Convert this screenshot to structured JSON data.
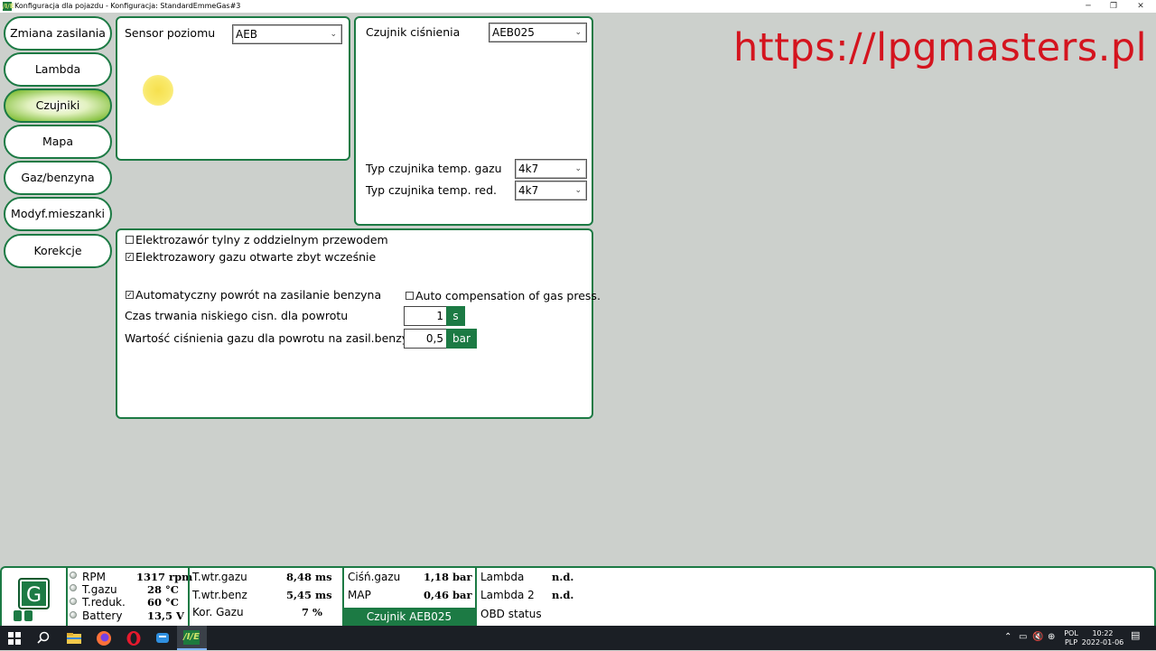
{
  "window": {
    "title": "Konfiguracja dla pojazdu - Konfiguracja: StandardEmmeGas#3",
    "logo_text": "/I/E",
    "controls": {
      "minimize": "─",
      "maximize": "❐",
      "close": "✕"
    }
  },
  "nav": {
    "items": [
      {
        "label": "Zmiana zasilania",
        "active": false
      },
      {
        "label": "Lambda",
        "active": false
      },
      {
        "label": "Czujniki",
        "active": true
      },
      {
        "label": "Mapa",
        "active": false
      },
      {
        "label": "Gaz/benzyna",
        "active": false
      },
      {
        "label": "Modyf.mieszanki",
        "active": false
      },
      {
        "label": "Korekcje",
        "active": false
      }
    ]
  },
  "level_panel": {
    "label": "Sensor poziomu",
    "value": "AEB"
  },
  "pressure_panel": {
    "label": "Czujnik ciśnienia",
    "value": "AEB025",
    "gas_temp_label": "Typ czujnika temp. gazu",
    "gas_temp_value": "4k7",
    "red_temp_label": "Typ czujnika temp. red.",
    "red_temp_value": "4k7"
  },
  "options_panel": {
    "rear_valve": {
      "label": "Elektrozawór tylny z oddzielnym przewodem",
      "checked": false
    },
    "valves_early": {
      "label": "Elektrozawory gazu otwarte zbyt wcześnie",
      "checked": true
    },
    "auto_return": {
      "label": "Automatyczny powrót na zasilanie benzyna",
      "checked": true
    },
    "auto_comp": {
      "label": "Auto compensation of gas press.",
      "checked": false
    },
    "low_press_time": {
      "label": "Czas trwania niskiego cisn. dla powrotu",
      "value": "1",
      "unit": "s"
    },
    "gas_press_value": {
      "label": "Wartość ciśnienia gazu dla powrotu na zasil.benzyną",
      "value": "0,5",
      "unit": "bar"
    }
  },
  "watermark": "https://lpgmasters.pl",
  "status": {
    "logo_letter": "G",
    "col1": [
      {
        "name": "RPM",
        "value": "1317 rpm"
      },
      {
        "name": "T.gazu",
        "value": "28 °C"
      },
      {
        "name": "T.reduk.",
        "value": "60 °C"
      },
      {
        "name": "Battery",
        "value": "13,5 V"
      }
    ],
    "col2": [
      {
        "name": "T.wtr.gazu",
        "value": "8,48 ms"
      },
      {
        "name": "T.wtr.benz",
        "value": "5,45 ms"
      },
      {
        "name": "Kor. Gazu",
        "value": "7 %"
      }
    ],
    "col3": [
      {
        "name": "Ciśń.gazu",
        "value": "1,18 bar"
      },
      {
        "name": "MAP",
        "value": "0,46 bar"
      }
    ],
    "col3_footer": "Czujnik AEB025",
    "col4": [
      {
        "name": "Lambda",
        "value": "n.d."
      },
      {
        "name": "Lambda 2",
        "value": "n.d."
      },
      {
        "name": "OBD status",
        "value": ""
      }
    ]
  },
  "taskbar": {
    "lang": "POL",
    "layout": "PLP",
    "time": "10:22",
    "date": "2022-01-06",
    "app_label": "/I/E"
  },
  "colors": {
    "accent": "#1c7a44",
    "background": "#ccd0cc",
    "watermark": "#d4141e"
  }
}
